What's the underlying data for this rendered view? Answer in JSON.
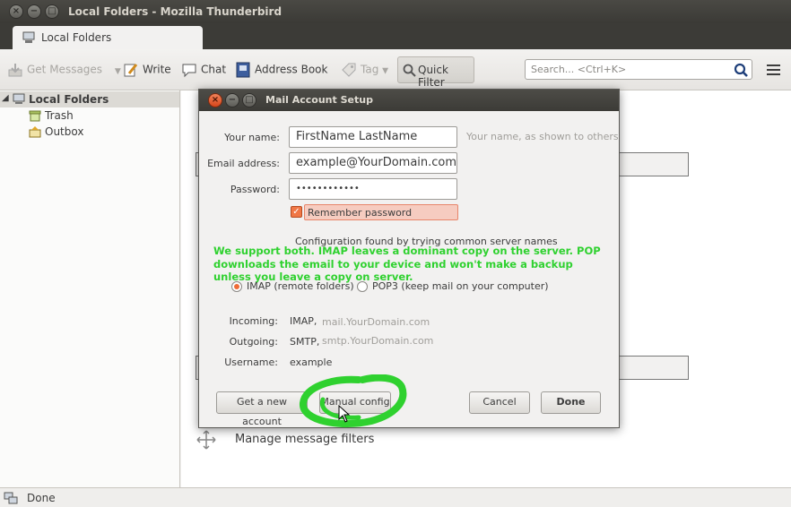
{
  "window": {
    "title": "Local Folders - Mozilla Thunderbird"
  },
  "tab": {
    "label": "Local Folders"
  },
  "toolbar": {
    "get_messages": "Get Messages",
    "write": "Write",
    "chat": "Chat",
    "address_book": "Address Book",
    "tag": "Tag",
    "quick_filter": "Quick Filter",
    "search_placeholder": "Search... <Ctrl+K>"
  },
  "folders": {
    "root": "Local Folders",
    "items": [
      {
        "label": "Trash"
      },
      {
        "label": "Outbox"
      }
    ]
  },
  "main": {
    "manage_filters": "Manage message filters"
  },
  "status": {
    "text": "Done"
  },
  "dialog": {
    "title": "Mail Account Setup",
    "name_label": "Your name:",
    "name_value": "FirstName LastName",
    "name_hint": "Your name, as shown to others",
    "email_label": "Email address:",
    "email_value": "example@YourDomain.com",
    "password_label": "Password:",
    "password_value": "••••••••••••",
    "remember_label": "Remember password",
    "config_found": "Configuration found by trying common server names",
    "annotation": "We support both. IMAP leaves a dominant copy on the server. POP downloads the email to your device and won't make a backup unless you leave a copy on server.",
    "imap_label": "IMAP (remote folders)",
    "pop_label": "POP3 (keep mail on your computer)",
    "incoming_label": "Incoming:",
    "incoming_protocol": "IMAP,",
    "incoming_host": "mail.YourDomain.com",
    "outgoing_label": "Outgoing:",
    "outgoing_protocol": "SMTP,",
    "outgoing_host": "smtp.YourDomain.com",
    "username_label": "Username:",
    "username_value": "example",
    "get_account_button": "Get a new account",
    "manual_config_button": "Manual config",
    "cancel_button": "Cancel",
    "done_button": "Done"
  },
  "colors": {
    "accent": "#ef6b37",
    "annotation": "#2fd12f",
    "titlebar": "#3c3b37"
  }
}
